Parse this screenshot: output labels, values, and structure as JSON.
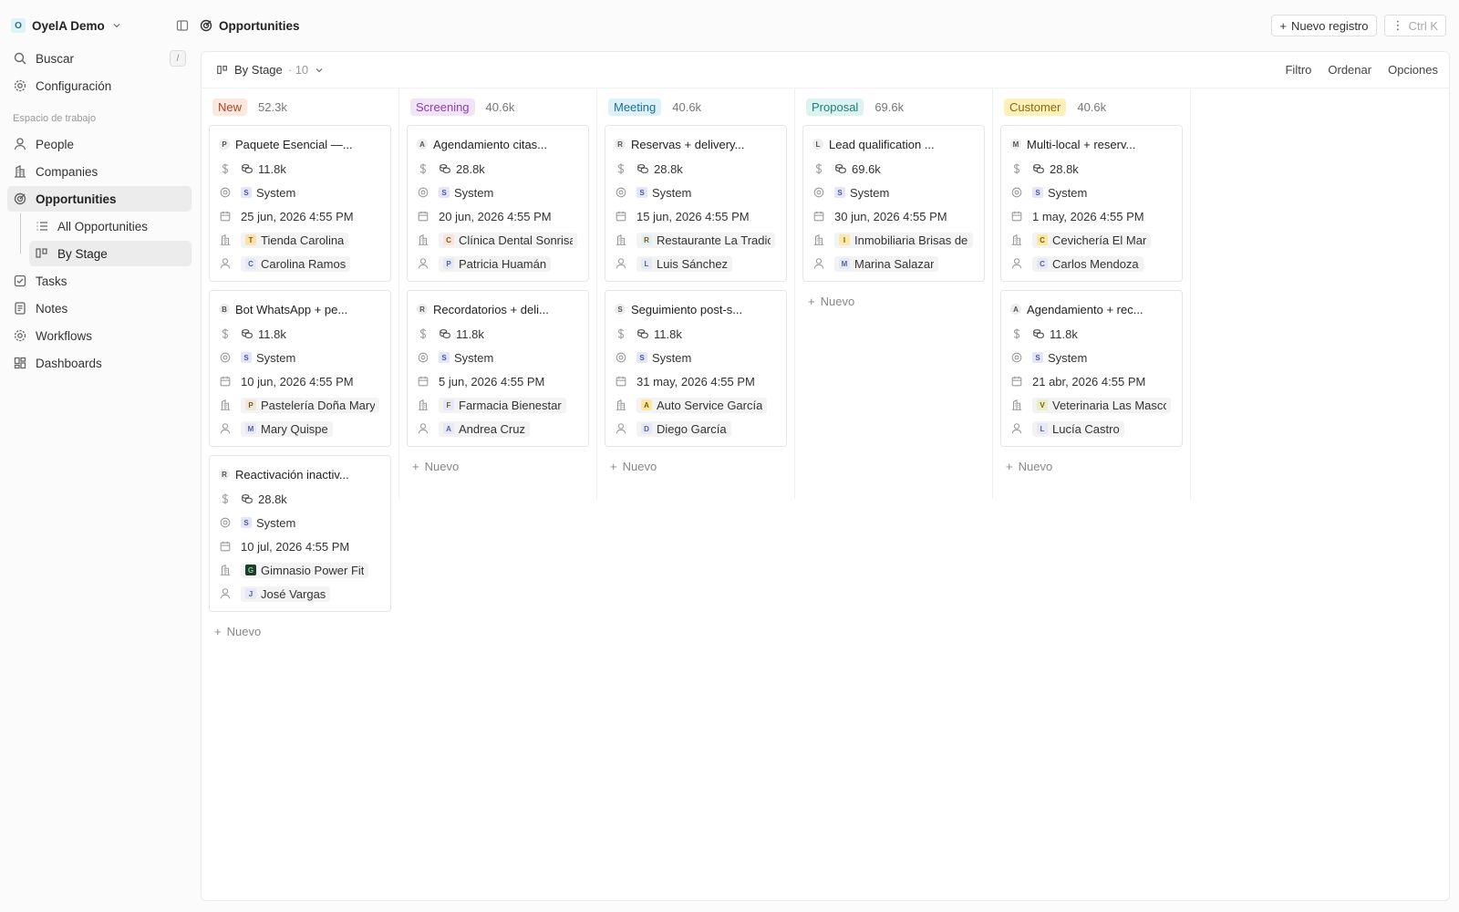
{
  "workspace": {
    "initial": "O",
    "name": "OyelA Demo"
  },
  "sidebar": {
    "search": "Buscar",
    "search_key": "/",
    "settings": "Configuración",
    "section": "Espacio de trabajo",
    "items": [
      "People",
      "Companies",
      "Opportunities",
      "Tasks",
      "Notes",
      "Workflows",
      "Dashboards"
    ],
    "subitems": [
      "All Opportunities",
      "By Stage"
    ]
  },
  "topbar": {
    "title": "Opportunities",
    "new_record": "Nuevo registro",
    "shortcut": "Ctrl K"
  },
  "toolbar": {
    "view": "By Stage",
    "count": "· 10",
    "filter": "Filtro",
    "sort": "Ordenar",
    "options": "Opciones"
  },
  "new_label": "Nuevo",
  "columns": [
    {
      "name": "New",
      "total": "52.3k",
      "bg": "#fde8df",
      "fg": "#b5431c",
      "cards": [
        {
          "title": "Paquete Esencial —...",
          "initial": "P",
          "amount": "11.8k",
          "owner": "System",
          "date": "25 jun, 2026 4:55 PM",
          "company": "Tienda Carolina",
          "company_i": "T",
          "company_c": "#fbe3a7",
          "person": "Carolina Ramos",
          "person_i": "C"
        },
        {
          "title": "Bot WhatsApp + pe...",
          "initial": "B",
          "amount": "11.8k",
          "owner": "System",
          "date": "10 jun, 2026 4:55 PM",
          "company": "Pastelería Doña Mary",
          "company_i": "P",
          "company_c": "#f1e6da",
          "person": "Mary Quispe",
          "person_i": "M"
        },
        {
          "title": "Reactivación inactiv...",
          "initial": "R",
          "amount": "28.8k",
          "owner": "System",
          "date": "10 jul, 2026 4:55 PM",
          "company": "Gimnasio Power Fit",
          "company_i": "G",
          "company_c": "#1f3b2e",
          "person": "José Vargas",
          "person_i": "J"
        }
      ]
    },
    {
      "name": "Screening",
      "total": "40.6k",
      "bg": "#f1e4f9",
      "fg": "#8a3fae",
      "cards": [
        {
          "title": "Agendamiento citas...",
          "initial": "A",
          "amount": "28.8k",
          "owner": "System",
          "date": "20 jun, 2026 4:55 PM",
          "company": "Clínica Dental Sonrisa",
          "company_i": "C",
          "company_c": "#fbe3dc",
          "person": "Patricia Huamán",
          "person_i": "P"
        },
        {
          "title": "Recordatorios + deli...",
          "initial": "R",
          "amount": "11.8k",
          "owner": "System",
          "date": "5 jun, 2026 4:55 PM",
          "company": "Farmacia Bienestar",
          "company_i": "F",
          "company_c": "#e3e8fb",
          "person": "Andrea Cruz",
          "person_i": "A"
        }
      ]
    },
    {
      "name": "Meeting",
      "total": "40.6k",
      "bg": "#dff1f8",
      "fg": "#1d6f93",
      "cards": [
        {
          "title": "Reservas + delivery...",
          "initial": "R",
          "amount": "28.8k",
          "owner": "System",
          "date": "15 jun, 2026 4:55 PM",
          "company": "Restaurante La Tradición",
          "company_i": "R",
          "company_c": "#dff1f5",
          "person": "Luis Sánchez",
          "person_i": "L"
        },
        {
          "title": "Seguimiento post-s...",
          "initial": "S",
          "amount": "11.8k",
          "owner": "System",
          "date": "31 may, 2026 4:55 PM",
          "company": "Auto Service García",
          "company_i": "A",
          "company_c": "#fbe7a0",
          "person": "Diego García",
          "person_i": "D"
        }
      ]
    },
    {
      "name": "Proposal",
      "total": "69.6k",
      "bg": "#dcf3f2",
      "fg": "#1f7e79",
      "cards": [
        {
          "title": "Lead qualification ...",
          "initial": "L",
          "amount": "69.6k",
          "owner": "System",
          "date": "30 jun, 2026 4:55 PM",
          "company": "Inmobiliaria Brisas del Mar",
          "company_i": "I",
          "company_c": "#fbeaa7",
          "person": "Marina Salazar",
          "person_i": "M"
        }
      ]
    },
    {
      "name": "Customer",
      "total": "40.6k",
      "bg": "#fdf0b8",
      "fg": "#8a6a10",
      "cards": [
        {
          "title": "Multi-local + reserv...",
          "initial": "M",
          "amount": "28.8k",
          "owner": "System",
          "date": "1 may, 2026 4:55 PM",
          "company": "Cevichería El Mar",
          "company_i": "C",
          "company_c": "#fbe9a0",
          "person": "Carlos Mendoza",
          "person_i": "C"
        },
        {
          "title": "Agendamiento + rec...",
          "initial": "A",
          "amount": "11.8k",
          "owner": "System",
          "date": "21 abr, 2026 4:55 PM",
          "company": "Veterinaria Las Mascotas",
          "company_i": "V",
          "company_c": "#e6efc6",
          "person": "Lucía Castro",
          "person_i": "L"
        }
      ]
    }
  ]
}
